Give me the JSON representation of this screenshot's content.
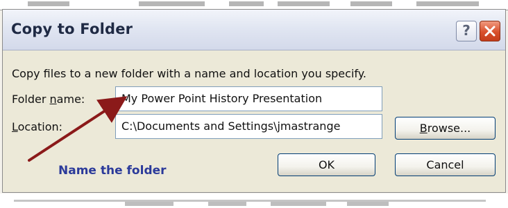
{
  "dialog": {
    "title": "Copy to Folder",
    "help_glyph": "?",
    "description": "Copy files to a new folder with a name and location you specify.",
    "folder_name": {
      "label_pre": "Folder ",
      "label_access": "n",
      "label_post": "ame:",
      "value": "My Power Point History Presentation"
    },
    "location": {
      "label_access": "L",
      "label_post": "ocation:",
      "value": "C:\\Documents and Settings\\jmastrange"
    },
    "browse_button": {
      "label_access": "B",
      "label_post": "rowse..."
    },
    "ok_button": "OK",
    "cancel_button": "Cancel"
  },
  "annotation": {
    "callout_text": "Name the folder",
    "callout_color": "#2b3a9a",
    "arrow_color": "#8b1a1a"
  },
  "icons": {
    "help": "help-icon",
    "close": "close-icon"
  }
}
